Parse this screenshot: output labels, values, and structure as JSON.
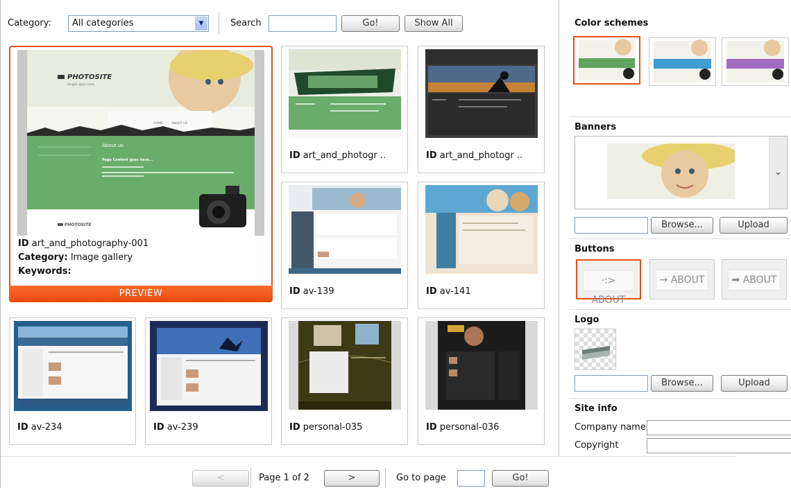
{
  "toolbar": {
    "category_label": "Category:",
    "category_value": "All categories",
    "search_label": "Search",
    "search_value": "",
    "go_label": "Go!",
    "show_all_label": "Show All"
  },
  "featured": {
    "id_label": "ID",
    "id_value": "art_and_photography-001",
    "category_label": "Category:",
    "category_value": "Image gallery",
    "keywords_label": "Keywords:",
    "keywords_value": "",
    "preview_label": "PREVIEW",
    "thumb_texts": {
      "brand": "PHOTOSITE",
      "tagline": "Slogan goes here",
      "nav_home": "HOME",
      "nav_about": "ABOUT US",
      "about_heading": "About us",
      "content_heading": "Page Content goes here...",
      "footer_brand": "PHOTOSITE"
    }
  },
  "templates": [
    {
      "id_label": "ID",
      "id": "art_and_photogr ..",
      "palette": "green"
    },
    {
      "id_label": "ID",
      "id": "art_and_photogr ..",
      "palette": "dark"
    },
    {
      "id_label": "ID",
      "id": "av-139",
      "palette": "mv"
    },
    {
      "id_label": "ID",
      "id": "av-141",
      "palette": "beige"
    },
    {
      "id_label": "ID",
      "id": "av-234",
      "palette": "blue"
    },
    {
      "id_label": "ID",
      "id": "av-239",
      "palette": "navy"
    },
    {
      "id_label": "ID",
      "id": "personal-035",
      "palette": "olive"
    },
    {
      "id_label": "ID",
      "id": "personal-036",
      "palette": "black"
    }
  ],
  "panel": {
    "color_schemes_title": "Color schemes",
    "schemes": [
      {
        "accent": "#5fa55f",
        "selected": true
      },
      {
        "accent": "#3e9ed1",
        "selected": false
      },
      {
        "accent": "#a36cc2",
        "selected": false
      }
    ],
    "banners_title": "Banners",
    "browse_label": "Browse...",
    "upload_label": "Upload",
    "buttons_title": "Buttons",
    "button_options": [
      {
        "label": "·:> ABOUT",
        "selected": true
      },
      {
        "label": "→ ABOUT",
        "selected": false
      },
      {
        "label": "➡ ABOUT",
        "selected": false
      }
    ],
    "logo_title": "Logo",
    "site_info_title": "Site info",
    "company_name_label": "Company name",
    "company_name_value": "",
    "copyright_label": "Copyright",
    "copyright_value": ""
  },
  "pager": {
    "prev_label": "<",
    "page_text": "Page 1 of 2",
    "next_label": ">",
    "goto_label": "Go to page",
    "goto_value": "",
    "go_label": "Go!"
  },
  "colors": {
    "accent": "#ee4e1a",
    "field_border": "#7f9db9"
  }
}
